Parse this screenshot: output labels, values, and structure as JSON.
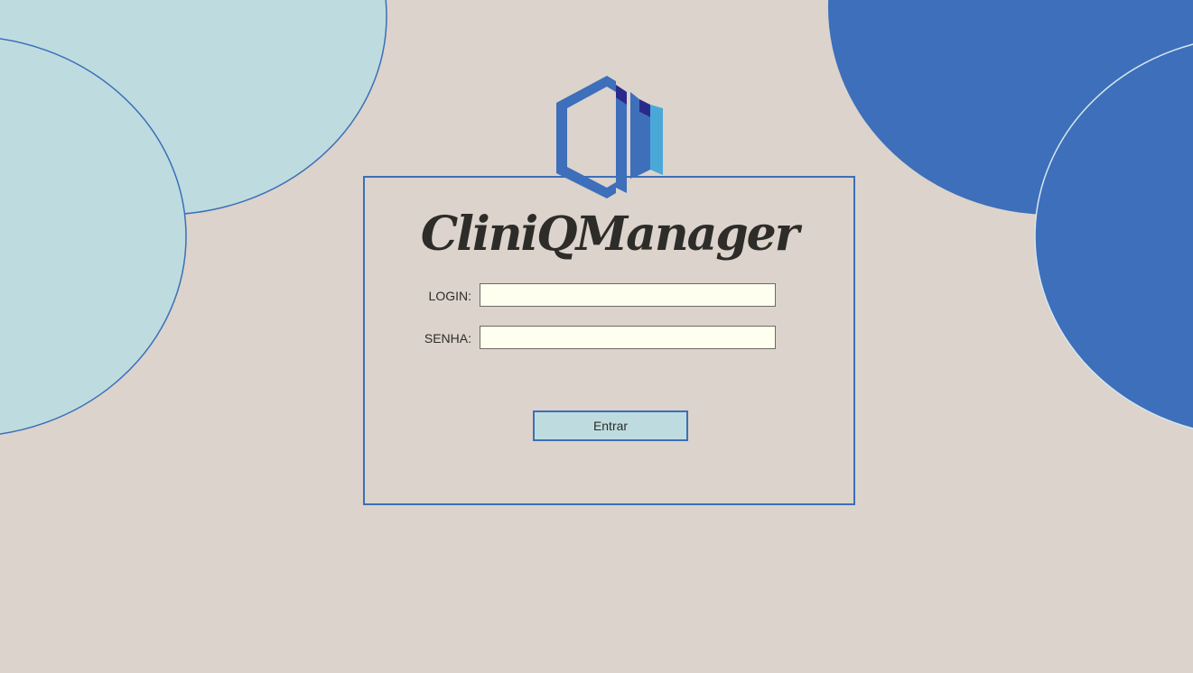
{
  "app": {
    "brand_name": "CliniQManager"
  },
  "login_form": {
    "login_label": "LOGIN:",
    "login_value": "",
    "password_label": "SENHA:",
    "password_value": "",
    "submit_label": "Entrar"
  },
  "colors": {
    "background": "#dbd3cc",
    "light_blob": "#bedcdf",
    "dark_blob": "#3d6fba",
    "panel_border": "#3c6fb8",
    "input_background": "#fffff0",
    "logo_primary": "#3d6fba",
    "logo_dark": "#2a2a8c",
    "logo_light": "#4aa8d8"
  },
  "icons": {
    "logo": "clinic-building-logo-icon"
  }
}
